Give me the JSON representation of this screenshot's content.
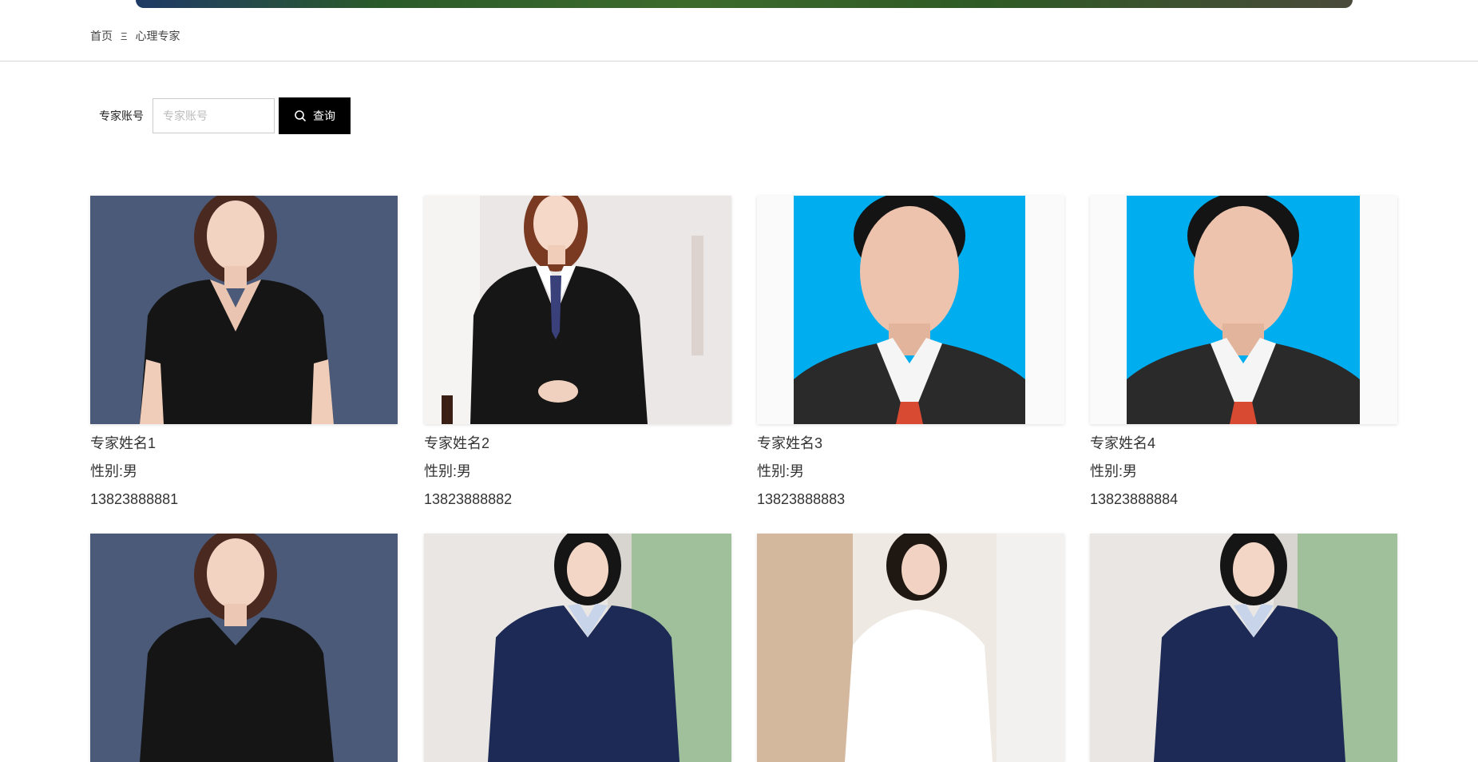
{
  "breadcrumb": {
    "home": "首页",
    "separator": "Ξ",
    "current": "心理专家"
  },
  "search": {
    "label": "专家账号",
    "placeholder": "专家账号",
    "value": "",
    "button_label": "查询",
    "button_icon": "search-icon"
  },
  "experts": [
    {
      "name": "专家姓名1",
      "gender": "性别:男",
      "phone": "13823888881",
      "photo": "woman-black-shirt"
    },
    {
      "name": "专家姓名2",
      "gender": "性别:男",
      "phone": "13823888882",
      "photo": "woman-suit-tie"
    },
    {
      "name": "专家姓名3",
      "gender": "性别:男",
      "phone": "13823888883",
      "photo": "man-blue-background"
    },
    {
      "name": "专家姓名4",
      "gender": "性别:男",
      "phone": "13823888884",
      "photo": "man-blue-background"
    }
  ],
  "second_row_photos": [
    "woman-black-shirt",
    "woman-navy-suit",
    "woman-white-blouse",
    "woman-navy-suit"
  ]
}
